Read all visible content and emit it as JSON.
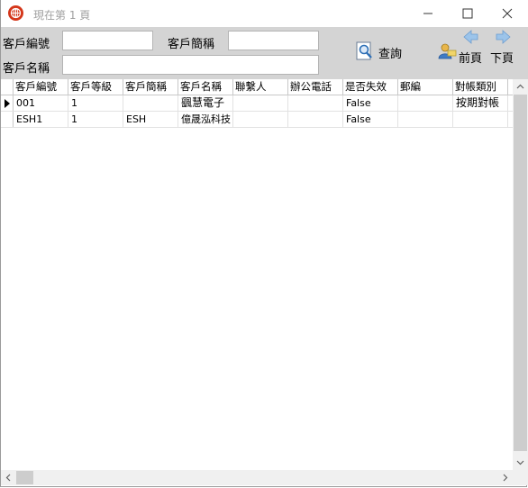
{
  "window": {
    "title": "現在第 1 頁"
  },
  "search": {
    "customer_code_label": "客戶編號",
    "customer_code_value": "",
    "customer_short_label": "客戶簡稱",
    "customer_short_value": "",
    "customer_name_label": "客戶名稱",
    "customer_name_value": "",
    "query_label": "查詢",
    "prev_label": "前頁",
    "next_label": "下頁"
  },
  "grid": {
    "columns": [
      "客戶編號",
      "客戶等級",
      "客戶簡稱",
      "客戶名稱",
      "聯繫人",
      "辦公電話",
      "是否失效",
      "郵編",
      "對帳類別"
    ],
    "rows": [
      [
        "001",
        "1",
        "",
        "颻慧電子",
        "",
        "",
        "False",
        "",
        "按期對帳"
      ],
      [
        "ESH1",
        "1",
        "ESH",
        "億晟泓科技",
        "",
        "",
        "False",
        "",
        ""
      ]
    ]
  },
  "colors": {
    "panel": "#d4d4d4",
    "accent_blue": "#2d6fb6"
  },
  "icons": {
    "app": "globe-icon",
    "query": "magnifier-icon",
    "prev": "left-arrow-icon",
    "next": "right-arrow-icon"
  }
}
